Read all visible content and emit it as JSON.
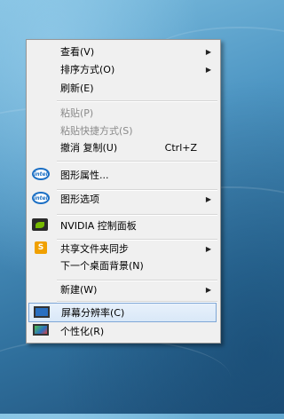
{
  "menu": {
    "items": [
      {
        "label": "查看(V)",
        "submenu": true
      },
      {
        "label": "排序方式(O)",
        "submenu": true
      },
      {
        "label": "刷新(E)"
      },
      {
        "label": "粘贴(P)",
        "disabled": true
      },
      {
        "label": "粘贴快捷方式(S)",
        "disabled": true
      },
      {
        "label": "撤消 复制(U)",
        "shortcut": "Ctrl+Z"
      },
      {
        "label": "图形属性...",
        "icon": "intel-graphics-icon"
      },
      {
        "label": "图形选项",
        "icon": "intel-graphics-icon",
        "submenu": true
      },
      {
        "label": "NVIDIA 控制面板",
        "icon": "nvidia-icon"
      },
      {
        "label": "共享文件夹同步",
        "icon": "shared-folder-sync-icon",
        "submenu": true
      },
      {
        "label": "下一个桌面背景(N)"
      },
      {
        "label": "新建(W)",
        "submenu": true
      },
      {
        "label": "屏幕分辨率(C)",
        "icon": "screen-resolution-icon",
        "highlighted": true
      },
      {
        "label": "个性化(R)",
        "icon": "personalize-icon"
      }
    ],
    "intel_text": "intel",
    "share_text": "S",
    "arrow": "▶"
  },
  "colors": {
    "menu_bg": "#f0f0f0",
    "highlight_border": "#7fa7d6",
    "disabled_text": "#8a8a8a"
  }
}
